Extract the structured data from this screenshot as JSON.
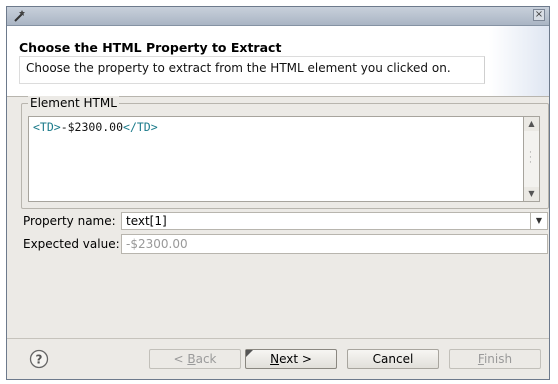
{
  "window": {
    "close_glyph": "×"
  },
  "header": {
    "title": "Choose the HTML Property to Extract",
    "description": "Choose the property to extract from the HTML element you clicked on."
  },
  "element_html": {
    "group_label": "Element HTML",
    "open_tag": "<TD>",
    "text": "-$2300.00",
    "close_tag": "</TD>"
  },
  "form": {
    "property_label": "Property name:",
    "property_value": "text[1]",
    "expected_label": "Expected value:",
    "expected_value": "-$2300.00"
  },
  "buttons": {
    "back_prefix": "< ",
    "back_mnemonic": "B",
    "back_rest": "ack",
    "next_mnemonic": "N",
    "next_rest": "ext >",
    "cancel": "Cancel",
    "finish_mnemonic": "F",
    "finish_rest": "inish"
  },
  "icons": {
    "app": "wizard-icon",
    "help": "help-icon",
    "close": "close-icon",
    "scroll_up": "chevron-up-icon",
    "scroll_down": "chevron-down-icon",
    "dropdown": "chevron-down-icon"
  }
}
